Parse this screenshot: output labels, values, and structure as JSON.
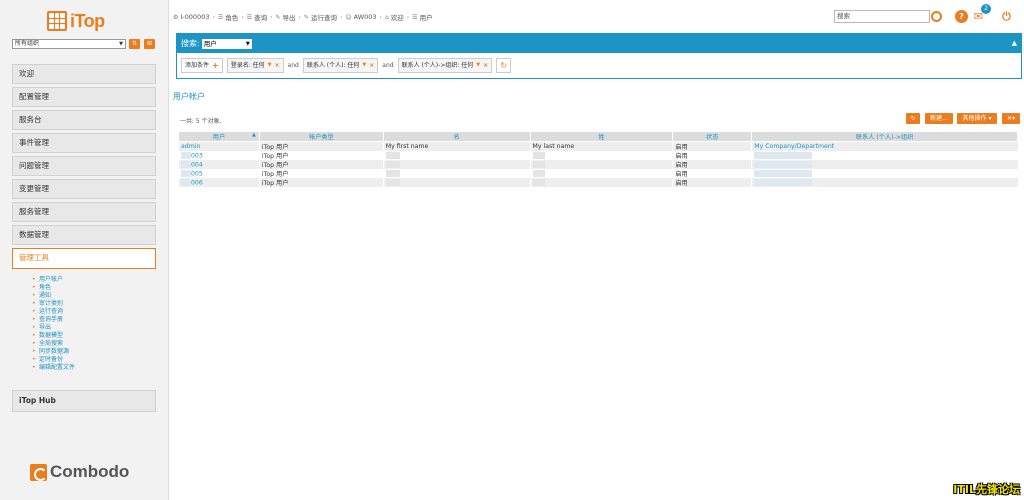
{
  "brand": {
    "logo_text": "iTop",
    "footer_logo_text": "Combodo",
    "brand_color": "#ea7d1e",
    "link_color": "#1c94c4"
  },
  "sidebar": {
    "org_select": {
      "value": "所有组织"
    },
    "menu": [
      {
        "label": "欢迎"
      },
      {
        "label": "配置管理"
      },
      {
        "label": "服务台"
      },
      {
        "label": "事件管理"
      },
      {
        "label": "问题管理"
      },
      {
        "label": "变更管理"
      },
      {
        "label": "服务管理"
      },
      {
        "label": "数据管理"
      },
      {
        "label": "管理工具",
        "active": true
      }
    ],
    "submenu": [
      "用户帐户",
      "角色",
      "通知",
      "审计类别",
      "运行查询",
      "查询手册",
      "导出",
      "数据模型",
      "全局搜索",
      "同步数据源",
      "定时备份",
      "编辑配置文件"
    ],
    "hub_label": "iTop Hub"
  },
  "breadcrumb": [
    {
      "icon": "gear-icon",
      "label": "I-000003"
    },
    {
      "icon": "list-icon",
      "label": "角色"
    },
    {
      "icon": "list-icon",
      "label": "查询"
    },
    {
      "icon": "wrench-icon",
      "label": "导出"
    },
    {
      "icon": "wrench-icon",
      "label": "运行查询"
    },
    {
      "icon": "user-icon",
      "label": "AW003"
    },
    {
      "icon": "home-icon",
      "label": "欢迎"
    },
    {
      "icon": "list-icon",
      "label": "用户"
    }
  ],
  "topbar": {
    "search_placeholder": "搜索",
    "notification_count": "2"
  },
  "search": {
    "title": "搜索:",
    "class_value": "用户",
    "add_criteria": "添加条件",
    "and": "and",
    "criteria": [
      "登录名: 任何",
      "联系人 (个人): 任何",
      "联系人 (个人)->组织: 任何"
    ]
  },
  "results": {
    "title": "用户帐户",
    "count_text": "一共: 5 个对象.",
    "new_button": "新建...",
    "other_actions": "其他操作",
    "columns": [
      "用户",
      "帐户类型",
      "名",
      "姓",
      "状态",
      "联系人 (个人)->组织"
    ],
    "rows": [
      {
        "login": "admin",
        "type": "iTop 用户",
        "first": "My first name",
        "last": "My last name",
        "status": "启用",
        "org": "My Company/Department"
      },
      {
        "login": "003",
        "type": "iTop 用户",
        "first": "",
        "last": "",
        "status": "启用",
        "org": ""
      },
      {
        "login": "004",
        "type": "iTop 用户",
        "first": "",
        "last": "",
        "status": "启用",
        "org": ""
      },
      {
        "login": "005",
        "type": "iTop 用户",
        "first": "",
        "last": "",
        "status": "启用",
        "org": ""
      },
      {
        "login": "006",
        "type": "iTop 用户",
        "first": "",
        "last": "",
        "status": "启用",
        "org": ""
      }
    ]
  },
  "watermark": "ITIL先锋论坛"
}
